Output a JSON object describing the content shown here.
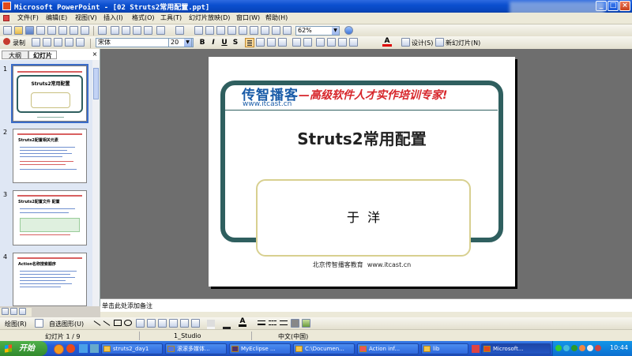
{
  "window": {
    "title": "Microsoft PowerPoint - [02 Struts2常用配置.ppt]",
    "controls": [
      "_",
      "□",
      "×"
    ]
  },
  "menubar": {
    "items": [
      "文件(F)",
      "编辑(E)",
      "视图(V)",
      "插入(I)",
      "格式(O)",
      "工具(T)",
      "幻灯片放映(D)",
      "窗口(W)",
      "帮助(H)"
    ]
  },
  "toolbar_standard": {
    "zoom": "62%"
  },
  "toolbar_format": {
    "record_label": "录制",
    "font_name": "宋体",
    "font_size": "20",
    "bold": "B",
    "italic": "I",
    "underline": "U",
    "shadow": "S",
    "design_label": "设计(S)",
    "new_slide_label": "新幻灯片(N)"
  },
  "left_pane": {
    "tabs": [
      "大纲",
      "幻灯片"
    ],
    "active_tab": "幻灯片",
    "thumbnails": [
      {
        "number": "1",
        "title": "Struts2常用配置"
      },
      {
        "number": "2",
        "title": "Struts2配置相关元素"
      },
      {
        "number": "3",
        "title": "Struts2配置文件 配置"
      },
      {
        "number": "4",
        "title": "Action名称搜索顺序"
      }
    ]
  },
  "slide": {
    "logo_main": "传智播客",
    "logo_url": "www.itcast.cn",
    "slogan": "—高级软件人才实作培训专家!",
    "title": "Struts2常用配置",
    "author": "于  洋",
    "footer": "北京传智播客教育  www.itcast.cn"
  },
  "notes": {
    "placeholder": "单击此处添加备注"
  },
  "draw_toolbar": {
    "draw_label": "绘图(R)",
    "autoshape_label": "自选图形(U)"
  },
  "statusbar": {
    "slide_pos": "幻灯片 1 / 9",
    "design": "1_Studio",
    "language": "中文(中国)"
  },
  "taskbar": {
    "start_label": "开始",
    "tasks": [
      "struts2_day1",
      "滚滚多媒体...",
      "MyEclipse ...",
      "C:\\Documen...",
      "Action inf...",
      "lib",
      "Microsoft..."
    ],
    "active_task": "Microsoft...",
    "clock": "10:44"
  },
  "colors": {
    "accent": "#2456c4",
    "slide_frame": "#2f5f5f",
    "slogan_red": "#d7262b",
    "author_box": "#d8d090"
  }
}
